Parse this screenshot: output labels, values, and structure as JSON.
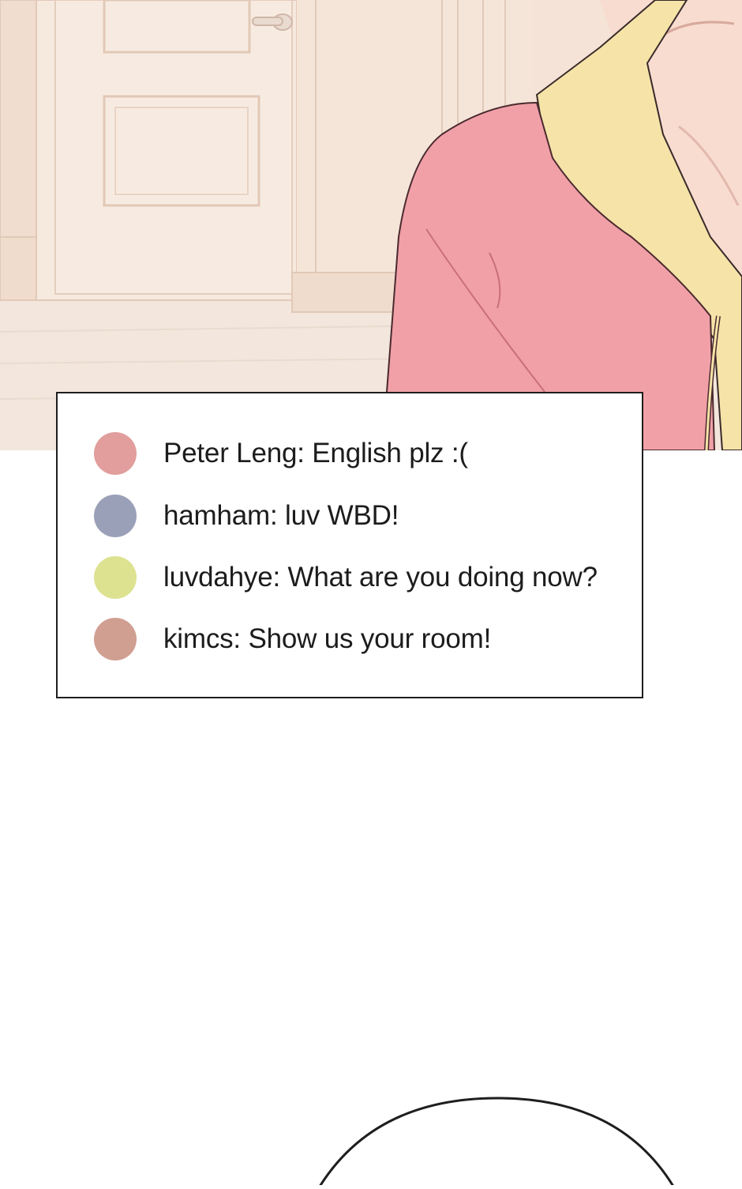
{
  "scene": {
    "icon": "room-illustration",
    "colors": {
      "wall": "#f4e3d6",
      "floor": "#f3e6dc",
      "trim": "#e7cfbd",
      "hoodie": "#f1a0a8",
      "hood_lining": "#f5e3a8",
      "skin": "#f8dcd0"
    }
  },
  "chat": {
    "messages": [
      {
        "user": "Peter Leng",
        "text": "Peter Leng: English plz :(",
        "color": "#e29d9d"
      },
      {
        "user": "hamham",
        "text": "hamham: luv WBD!",
        "color": "#9aa0b8"
      },
      {
        "user": "luvdahye",
        "text": "luvdahye: What are you doing now?",
        "color": "#dde291"
      },
      {
        "user": "kimcs",
        "text": "kimcs: Show us your room!",
        "color": "#d09f91"
      }
    ]
  },
  "bubble": {
    "icon": "speech-bubble-outline"
  }
}
